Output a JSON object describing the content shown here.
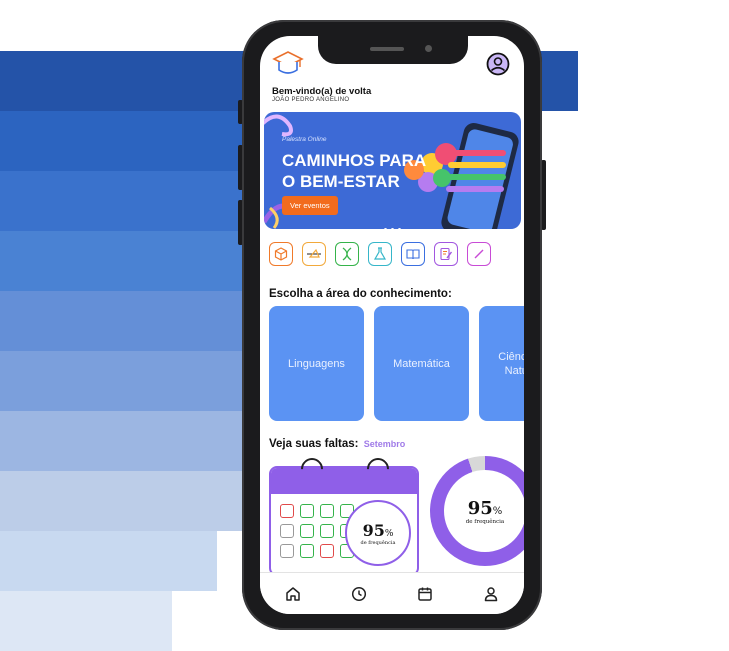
{
  "background": {
    "stripe_colors": [
      "#2453a8",
      "#2c64c0",
      "#3a72cc",
      "#4a82d3",
      "#648fd7",
      "#7b9fdc",
      "#9cb6e2",
      "#bccde8",
      "#c8d9f0",
      "#dde7f5"
    ]
  },
  "header": {
    "welcome": "Bem-vindo(a) de volta",
    "username": "JOÃO PEDRO ANGELINO",
    "logo_icon": "graduation-cap-icon",
    "profile_icon": "user-circle-icon"
  },
  "banner": {
    "subtitle": "Palestra Online",
    "title": "CAMINHOS PARA O BEM-ESTAR",
    "button_label": "Ver eventos",
    "accent": "#f26b1d",
    "background": "#3d6ad6"
  },
  "categories": [
    {
      "icon": "cube-icon",
      "color": "#f07a2a"
    },
    {
      "icon": "ruler-triangle-icon",
      "color": "#f2a93b"
    },
    {
      "icon": "dna-icon",
      "color": "#35b34a"
    },
    {
      "icon": "flask-icon",
      "color": "#36b6c9"
    },
    {
      "icon": "book-icon",
      "color": "#3b6fe0"
    },
    {
      "icon": "edit-note-icon",
      "color": "#a257e0"
    },
    {
      "icon": "pencil-icon",
      "color": "#c84bd6"
    }
  ],
  "areas": {
    "title": "Escolha a área do conhecimento:",
    "cards": [
      {
        "label": "Linguagens"
      },
      {
        "label": "Matemática"
      },
      {
        "label": "Ciências da Natureza"
      }
    ]
  },
  "faltas": {
    "title": "Veja suas faltas:",
    "month": "Setembro",
    "percent": "95",
    "percent_sign": "%",
    "caption": "de frequência",
    "value": 95
  },
  "nav": [
    {
      "icon": "home-icon"
    },
    {
      "icon": "clock-icon"
    },
    {
      "icon": "calendar-icon"
    },
    {
      "icon": "profile-icon"
    }
  ]
}
